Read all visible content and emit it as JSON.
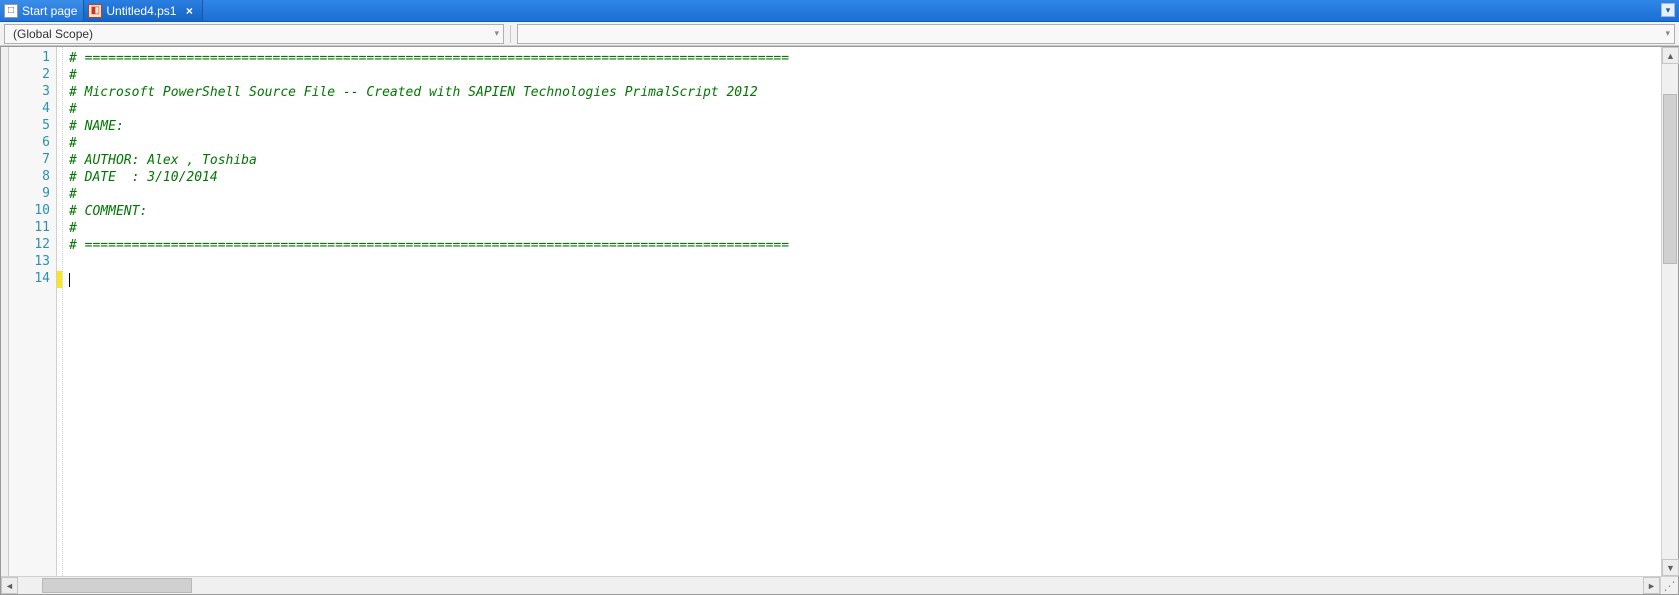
{
  "tabs": [
    {
      "label": "Start page",
      "active": false,
      "closable": false,
      "icon": "doc"
    },
    {
      "label": "Untitled4.ps1",
      "active": true,
      "closable": true,
      "icon": "ps"
    }
  ],
  "scope": {
    "left": "(Global Scope)",
    "right": ""
  },
  "editor": {
    "lines": [
      {
        "n": 1,
        "text": "# ==========================================================================================",
        "comment": true
      },
      {
        "n": 2,
        "text": "# ",
        "comment": true
      },
      {
        "n": 3,
        "text": "# Microsoft PowerShell Source File -- Created with SAPIEN Technologies PrimalScript 2012",
        "comment": true
      },
      {
        "n": 4,
        "text": "# ",
        "comment": true
      },
      {
        "n": 5,
        "text": "# NAME: ",
        "comment": true
      },
      {
        "n": 6,
        "text": "# ",
        "comment": true
      },
      {
        "n": 7,
        "text": "# AUTHOR: Alex , Toshiba",
        "comment": true
      },
      {
        "n": 8,
        "text": "# DATE  : 3/10/2014",
        "comment": true
      },
      {
        "n": 9,
        "text": "# ",
        "comment": true
      },
      {
        "n": 10,
        "text": "# COMMENT: ",
        "comment": true
      },
      {
        "n": 11,
        "text": "# ",
        "comment": true
      },
      {
        "n": 12,
        "text": "# ==========================================================================================",
        "comment": true
      },
      {
        "n": 13,
        "text": "",
        "comment": false
      },
      {
        "n": 14,
        "text": "",
        "comment": false,
        "caret": true,
        "modified": true
      }
    ]
  },
  "glyphs": {
    "close": "×",
    "chevDown": "▾",
    "triUp": "▲",
    "triDown": "▼",
    "triLeft": "◄",
    "triRight": "►",
    "resize": "⋰"
  }
}
